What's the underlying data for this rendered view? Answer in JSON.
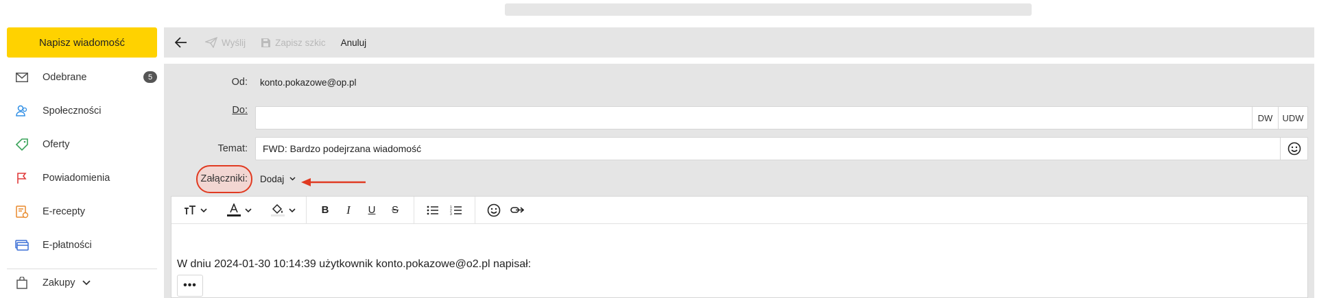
{
  "compose_label": "Napisz wiadomość",
  "sidebar": {
    "items": [
      {
        "label": "Odebrane",
        "badge": "5",
        "icon": "inbox-icon"
      },
      {
        "label": "Społeczności",
        "icon": "people-icon"
      },
      {
        "label": "Oferty",
        "icon": "tag-icon"
      },
      {
        "label": "Powiadomienia",
        "icon": "flag-icon"
      },
      {
        "label": "E-recepty",
        "icon": "prescription-icon"
      },
      {
        "label": "E-płatności",
        "icon": "card-icon"
      }
    ],
    "shopping_label": "Zakupy"
  },
  "toolbar": {
    "send_label": "Wyślij",
    "save_label": "Zapisz szkic",
    "cancel_label": "Anuluj"
  },
  "form": {
    "from_label": "Od:",
    "from_value": "konto.pokazowe@op.pl",
    "to_label": "Do:",
    "to_value": "",
    "cc_label": "DW",
    "bcc_label": "UDW",
    "subject_label": "Temat:",
    "subject_value": "FWD: Bardzo podejrzana wiadomość",
    "attachments_label": "Załączniki:",
    "add_label": "Dodaj"
  },
  "editor": {
    "body_text": "W dniu 2024-01-30 10:14:39 użytkownik konto.pokazowe@o2.pl napisał:",
    "more_label": "•••"
  },
  "colors": {
    "accent": "#ffd200",
    "annotation": "#e03a21",
    "panel": "#e5e5e5"
  }
}
